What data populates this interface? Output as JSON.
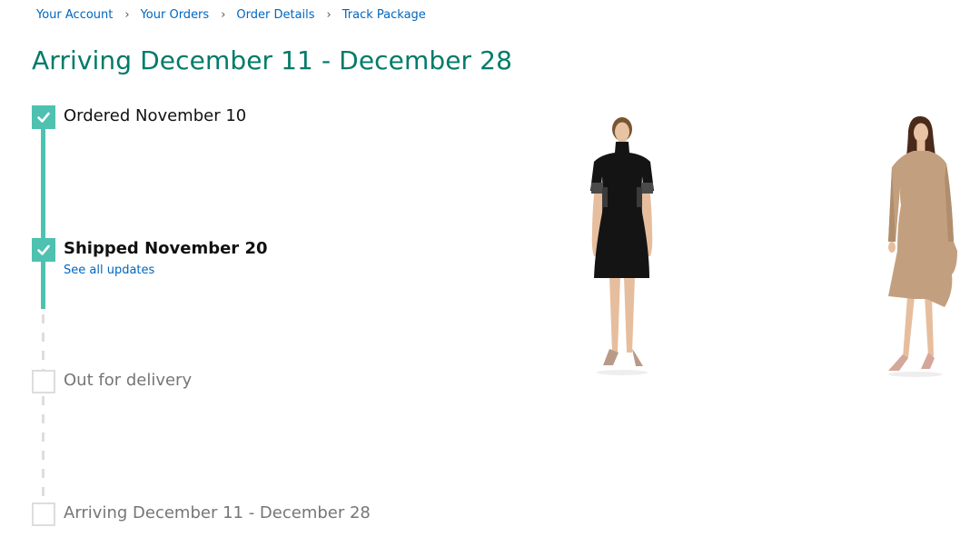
{
  "breadcrumb": {
    "items": [
      "Your Account",
      "Your Orders",
      "Order Details",
      "Track Package"
    ],
    "separator": "›"
  },
  "page_title": "Arriving December 11 - December 28",
  "timeline": {
    "steps": [
      {
        "label": "Ordered November 10",
        "status": "done"
      },
      {
        "label": "Shipped November 20",
        "status": "current",
        "link": "See all updates"
      },
      {
        "label": "Out for delivery",
        "status": "pending"
      },
      {
        "label": "Arriving December 11 - December 28",
        "status": "pending"
      }
    ]
  },
  "colors": {
    "accent": "#007b69",
    "progress": "#4fc1b0",
    "link": "#0066c0",
    "pending": "#dddddd"
  },
  "products": [
    {
      "icon": "black-short-sleeve-dress-image"
    },
    {
      "icon": "camel-long-sleeve-dress-image"
    }
  ]
}
